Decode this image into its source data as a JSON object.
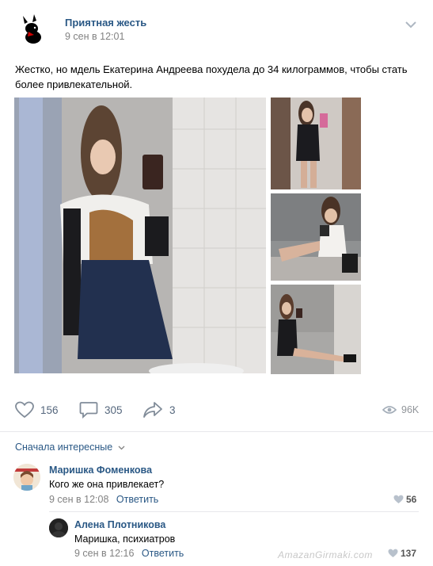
{
  "post": {
    "group_name": "Приятная жесть",
    "date": "9 сен в 12:01",
    "text": "Жестко, но мдель Екатерина Андреева похудела до 34 килограммов, чтобы стать более привлекательной."
  },
  "actions": {
    "likes": "156",
    "comments": "305",
    "shares": "3",
    "views": "96K"
  },
  "comments": {
    "sort_label": "Сначала интересные",
    "items": [
      {
        "author": "Маришка Фоменкова",
        "text": "Кого же она привлекает?",
        "date": "9 сен в 12:08",
        "reply_label": "Ответить",
        "likes": "56"
      },
      {
        "author": "Алена Плотникова",
        "text": "Маришка, психиатров",
        "date": "9 сен в 12:16",
        "reply_label": "Ответить",
        "likes": "137"
      }
    ]
  },
  "colors": {
    "link": "#2a5885",
    "meta": "#828282",
    "action": "#55677d"
  },
  "watermark": "AmazanGirmaki.com"
}
